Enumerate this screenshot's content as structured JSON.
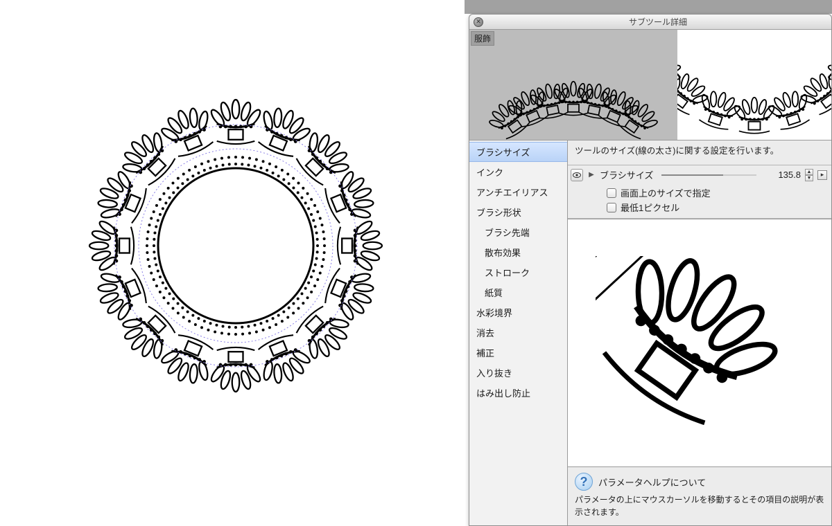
{
  "panel": {
    "title": "サブツール詳細",
    "preview_tag": "服飾"
  },
  "categories": [
    {
      "label": "ブラシサイズ",
      "selected": true,
      "sub": false
    },
    {
      "label": "インク",
      "selected": false,
      "sub": false
    },
    {
      "label": "アンチエイリアス",
      "selected": false,
      "sub": false
    },
    {
      "label": "ブラシ形状",
      "selected": false,
      "sub": false
    },
    {
      "label": "ブラシ先端",
      "selected": false,
      "sub": true
    },
    {
      "label": "散布効果",
      "selected": false,
      "sub": true
    },
    {
      "label": "ストローク",
      "selected": false,
      "sub": true
    },
    {
      "label": "紙質",
      "selected": false,
      "sub": true
    },
    {
      "label": "水彩境界",
      "selected": false,
      "sub": false
    },
    {
      "label": "消去",
      "selected": false,
      "sub": false
    },
    {
      "label": "補正",
      "selected": false,
      "sub": false
    },
    {
      "label": "入り抜き",
      "selected": false,
      "sub": false
    },
    {
      "label": "はみ出し防止",
      "selected": false,
      "sub": false
    }
  ],
  "description": "ツールのサイズ(線の太さ)に関する設定を行います。",
  "params": {
    "brush_size_label": "ブラシサイズ",
    "brush_size_value": "135.8",
    "check1": "画面上のサイズで指定",
    "check2": "最低1ピクセル"
  },
  "help": {
    "title": "パラメータヘルプについて",
    "body": "パラメータの上にマウスカーソルを移動するとその項目の説明が表示されます。"
  }
}
